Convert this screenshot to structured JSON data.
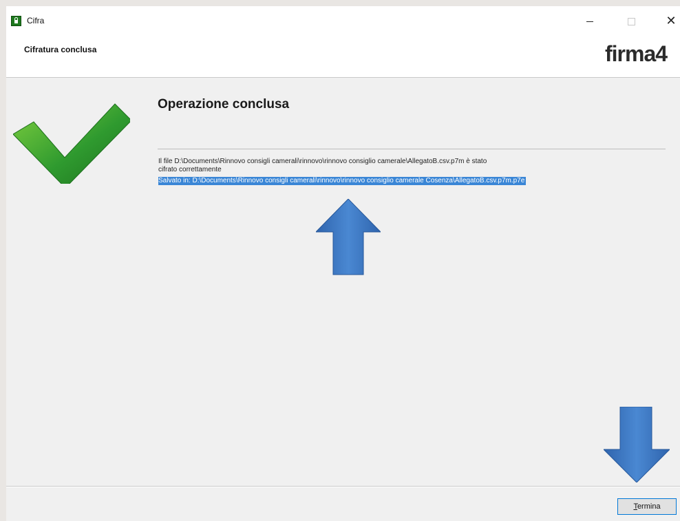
{
  "window": {
    "title": "Cifra"
  },
  "header": {
    "title": "Cifratura conclusa",
    "logo_text": "firma4"
  },
  "main": {
    "heading": "Operazione conclusa",
    "message_line1": "Il file D:\\Documents\\Rinnovo consigli camerali\\rinnovo\\rinnovo consiglio camerale\\AllegatoB.csv.p7m è stato",
    "message_line2": "cifrato correttamente",
    "saved_path": "Salvato in: D:\\Documents\\Rinnovo consigli camerali\\rinnovo\\rinnovo consiglio camerale Cosenza\\AllegatoB.csv.p7m.p7e"
  },
  "footer": {
    "button_mnemonic": "T",
    "button_rest": "ermina"
  },
  "icons": {
    "app": "lock-icon",
    "success": "checkmark-icon",
    "annotation_up": "arrow-up-icon",
    "annotation_down": "arrow-down-icon"
  },
  "colors": {
    "check_green": "#2f9a2f",
    "arrow_blue": "#3f78c2",
    "selection_blue": "#3a86d6",
    "button_border": "#0078d7"
  }
}
